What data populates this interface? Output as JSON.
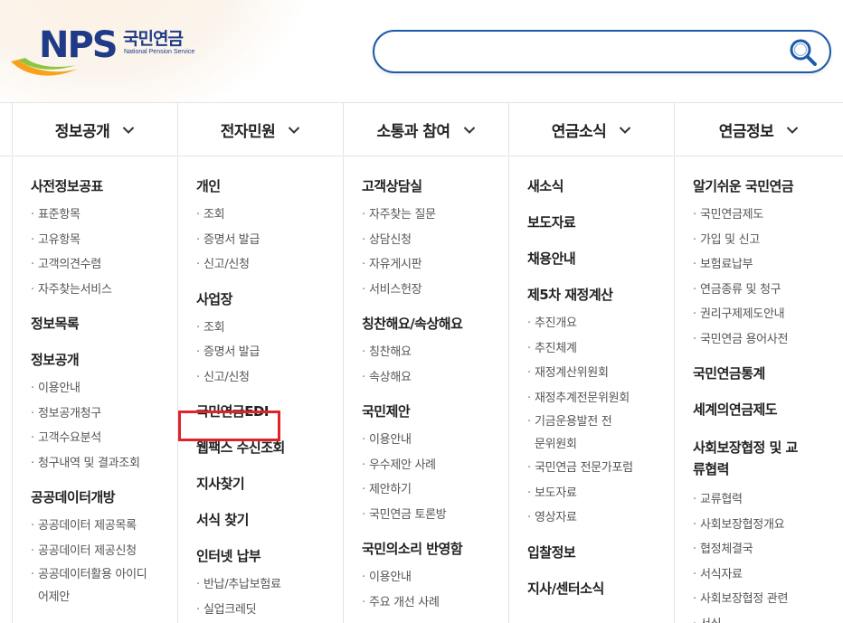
{
  "header": {
    "logo_mark": "NPS",
    "logo_korean": "국민연금",
    "logo_english": "National Pension Service",
    "search": {
      "value": "",
      "placeholder": ""
    },
    "brand_color": "#1f3b87",
    "accent_color": "#1d5aa8",
    "highlight_color": "#e0222a"
  },
  "nav": [
    {
      "label": "정보공개"
    },
    {
      "label": "전자민원"
    },
    {
      "label": "소통과 참여"
    },
    {
      "label": "연금소식"
    },
    {
      "label": "연금정보"
    }
  ],
  "columns": [
    {
      "groups": [
        {
          "title": "사전정보공표",
          "items": [
            "표준항목",
            "고유항목",
            "고객의견수렴",
            "자주찾는서비스"
          ]
        },
        {
          "title": "정보목록",
          "items": []
        },
        {
          "title": "정보공개",
          "items": [
            "이용안내",
            "정보공개청구",
            "고객수요분석",
            "청구내역 및 결과조회"
          ]
        },
        {
          "title": "공공데이터개방",
          "items": [
            "공공데이터 제공목록",
            "공공데이터 제공신청",
            "공공데이터활용 아이디어제안"
          ]
        }
      ]
    },
    {
      "groups": [
        {
          "title": "개인",
          "items": [
            "조회",
            "증명서 발급",
            "신고/신청"
          ]
        },
        {
          "title": "사업장",
          "items": [
            "조회",
            "증명서 발급",
            "신고/신청"
          ]
        },
        {
          "title": "국민연금EDI",
          "items": []
        },
        {
          "title": "웹팩스 수신조회",
          "items": []
        },
        {
          "title": "지사찾기",
          "items": []
        },
        {
          "title": "서식 찾기",
          "items": []
        },
        {
          "title": "인터넷 납부",
          "items": [
            "반납/추납보험료",
            "실업크레딧"
          ]
        }
      ]
    },
    {
      "groups": [
        {
          "title": "고객상담실",
          "items": [
            "자주찾는 질문",
            "상담신청",
            "자유게시판",
            "서비스헌장"
          ]
        },
        {
          "title": "칭찬해요/속상해요",
          "items": [
            "칭찬해요",
            "속상해요"
          ]
        },
        {
          "title": "국민제안",
          "items": [
            "이용안내",
            "우수제안 사례",
            "제안하기",
            "국민연금 토론방"
          ]
        },
        {
          "title": "국민의소리 반영함",
          "items": [
            "이용안내",
            "주요 개선 사례"
          ]
        }
      ]
    },
    {
      "groups": [
        {
          "title": "새소식",
          "items": []
        },
        {
          "title": "보도자료",
          "items": []
        },
        {
          "title": "채용안내",
          "items": []
        },
        {
          "title": "제5차 재정계산",
          "items": [
            "추진개요",
            "추진체계",
            "재정계산위원회",
            "재정추계전문위원회",
            "기금운용발전 전문위원회",
            "국민연금 전문가포럼",
            "보도자료",
            "영상자료"
          ]
        },
        {
          "title": "입찰정보",
          "items": []
        },
        {
          "title": "지사/센터소식",
          "items": []
        }
      ]
    },
    {
      "groups": [
        {
          "title": "알기쉬운 국민연금",
          "items": [
            "국민연금제도",
            "가입 및 신고",
            "보험료납부",
            "연금종류 및 청구",
            "권리구제제도안내",
            "국민연금 용어사전"
          ]
        },
        {
          "title": "국민연금통계",
          "items": []
        },
        {
          "title": "세계의연금제도",
          "items": []
        },
        {
          "title": "사회보장협정 및 교류협력",
          "items": [
            "교류협력",
            "사회보장협정개요",
            "협정체결국",
            "서식자료",
            "사회보장협정 관련",
            "서식"
          ]
        }
      ]
    }
  ]
}
